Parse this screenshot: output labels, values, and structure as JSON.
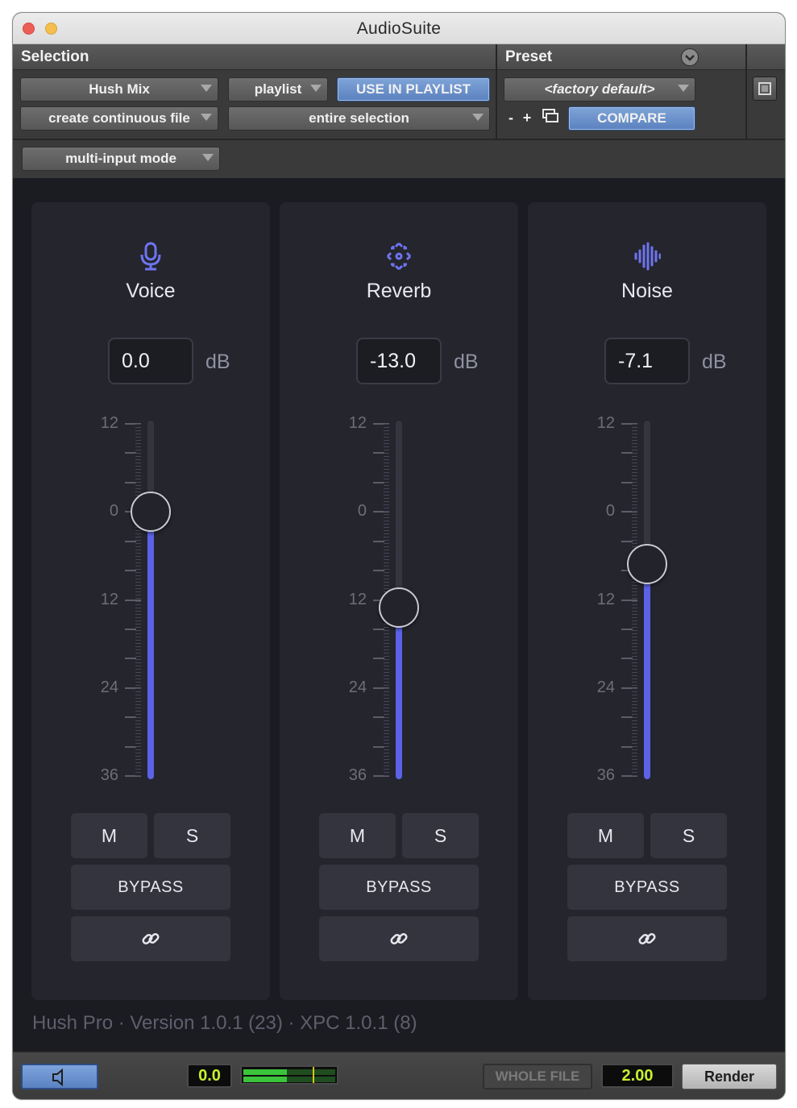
{
  "window": {
    "title": "AudioSuite"
  },
  "header": {
    "selection_label": "Selection",
    "preset_label": "Preset",
    "plugin_select": "Hush Mix",
    "playlist_select": "playlist",
    "use_in_playlist": "USE IN PLAYLIST",
    "file_mode_select": "create continuous file",
    "processing_select": "entire selection",
    "input_mode_select": "multi-input mode",
    "preset_select": "<factory default>",
    "preset_minus": "-",
    "preset_plus": "+",
    "compare": "COMPARE"
  },
  "scale_labels": [
    "12",
    "0",
    "12",
    "24",
    "36"
  ],
  "strips": [
    {
      "name": "Voice",
      "icon": "microphone-icon",
      "value": "0.0",
      "unit": "dB",
      "level_db": 0.0,
      "mute": "M",
      "solo": "S",
      "bypass": "BYPASS",
      "link_icon": "link-icon"
    },
    {
      "name": "Reverb",
      "icon": "reverb-icon",
      "value": "-13.0",
      "unit": "dB",
      "level_db": -13.0,
      "mute": "M",
      "solo": "S",
      "bypass": "BYPASS",
      "link_icon": "link-icon"
    },
    {
      "name": "Noise",
      "icon": "waveform-icon",
      "value": "-7.1",
      "unit": "dB",
      "level_db": -7.1,
      "mute": "M",
      "solo": "S",
      "bypass": "BYPASS",
      "link_icon": "link-icon"
    }
  ],
  "colors": {
    "accent": "#5b62e6",
    "icon": "#6e74f0",
    "lcd_text": "#c8f030",
    "ptools_blue": "#6b90cf"
  },
  "footer": {
    "version_text": "Hush Pro · Version 1.0.1 (23) · XPC 1.0.1 (8)"
  },
  "bottom": {
    "preview_icon": "speaker-icon",
    "gain_value": "0.0",
    "whole_file": "WHOLE FILE",
    "handle_value": "2.00",
    "render": "Render"
  }
}
